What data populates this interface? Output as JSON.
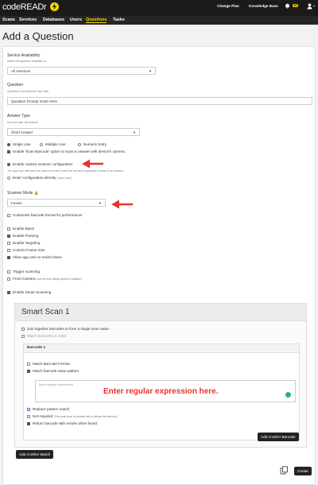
{
  "app": {
    "logo": "codeREADr"
  },
  "top_links": {
    "change_plan": "Change Plan",
    "knowledge_base": "Knowledge Base",
    "notif_count": "99"
  },
  "nav": [
    "Scans",
    "Services",
    "Databases",
    "Users",
    "Questions",
    "Tasks"
  ],
  "page_title": "Add a Question",
  "service_availability": {
    "label": "Service Availability",
    "help": "Make this question available to",
    "value": "All Services"
  },
  "question": {
    "label": "Question",
    "help": "Question to prompt the user with",
    "value": "Question Prompt Goes Here"
  },
  "answer_type": {
    "label": "Answer Type",
    "help": "how the user will answer",
    "value": "Short Answer"
  },
  "line_options": [
    "Single Line",
    "Multiple Line",
    "Numeric Entry"
  ],
  "scan_barcode_option": "Enable 'Scan Barcode' option to scan in answer with device's camera.",
  "custom_scanner": {
    "label": "Enable custom scanner configuration",
    "help": "The app user will have the option to enter it with the device's keyboard or scan in an answer."
  },
  "config_directly": {
    "label": "Enter configuration directly",
    "note": "(Learn more)"
  },
  "scanner_mode": {
    "label": "Scanner Mode",
    "value": "Fusion"
  },
  "customize_format": "Customize barcode format for performance",
  "feature_options": [
    "Enable Batch",
    "Enable Framing",
    "Enable Targeting",
    "Custom Frame Size",
    "Allow app user to resize frame"
  ],
  "trigger_scanning": "Trigger scanning",
  "front_camera": {
    "label": "Front Camera",
    "note": "(Use the front facing camera if available)"
  },
  "enable_smart": "Enable Smart Scanning",
  "smart_scan": {
    "title": "Smart Scan 1",
    "join_option": "Join together barcodes to form a single scan value.",
    "match_order": "Match barcodes in order",
    "barcode": {
      "title": "Barcode 1",
      "match_format": "Match Barcode Format",
      "match_pattern": "Match barcode value pattern",
      "regex_placeholder": "Input regular expression",
      "regex_note": "Enter regular expression here.",
      "replace_match": "Replace pattern match",
      "not_required": {
        "label": "Not required",
        "note": "(This smart scan is possible with or without this barcode.)"
      },
      "return_barcode": "Return barcode with results when found"
    },
    "add_barcode_button": "Add Another Barcode"
  },
  "add_match_button": "Add Another Match",
  "create_button": "Create",
  "colors": {
    "accent": "#f5d800",
    "annotation": "#e8322f",
    "topbar": "#1a1a1a"
  }
}
